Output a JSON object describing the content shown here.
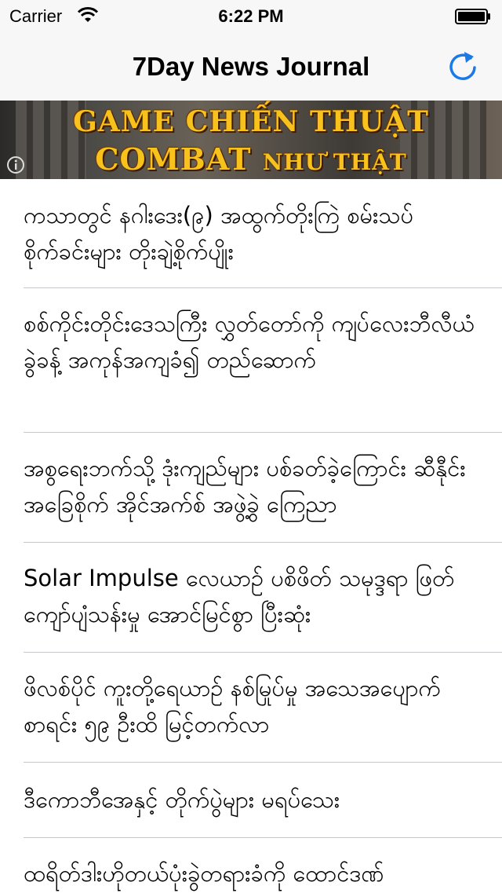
{
  "status_bar": {
    "carrier": "Carrier",
    "time": "6:22 PM",
    "wifi_icon": "wifi-icon",
    "battery_icon": "battery-icon"
  },
  "nav": {
    "title": "7Day News Journal",
    "refresh_icon": "refresh-icon",
    "accent_color": "#1a7ae8"
  },
  "banner": {
    "line1": "GAME CHIẾN THUẬT",
    "line2_big": "COMBAT",
    "line2_small": "NHƯ THẬT",
    "info_icon": "info-icon"
  },
  "articles": [
    {
      "title": "ကသာတွင် နဂါးဒေး(၉) အထွက်တိုးကြဲ စမ်းသပ်စိုက်ခင်းများ တိုးချဲ့စိုက်ပျိုး"
    },
    {
      "title": "စစ်ကိုင်းတိုင်းဒေသကြီး လွှတ်တော်ကို ကျပ်လေးဘီလီယံခွဲခန့် အကုန်အကျခံ၍ တည်ဆောက်"
    },
    {
      "title": "အစွရေးဘက်သို့ ဒုံးကျည်များ ပစ်ခတ်ခဲ့ကြောင်း ဆီနီုင်းအခြေစိုက် အိုင်အက်စ် အဖွဲ့ခွဲ ကြေညာ"
    },
    {
      "title": "Solar Impulse လေယာဉ် ပစိဖိတ် သမုဒ္ဒရာ ဖြတ်ကျော်ပျံသန်းမှု အောင်မြင်စွာ ပြီးဆုံး"
    },
    {
      "title": "ဖိလစ်ပိုင် ကူးတို့ရေယာဉ် နစ်မြုပ်မှု အသေအပျောက်စာရင်း ၅၉ ဦးထိ မြင့်တက်လာ"
    },
    {
      "title": "ဒီကောဘီအေနှင့် တိုက်ပွဲများ မရပ်သေး"
    },
    {
      "title": "ထရိတ်ဒါးဟိုတယ်ပုံးခွဲတရားခံကို ထောင်ဒဏ်"
    }
  ]
}
